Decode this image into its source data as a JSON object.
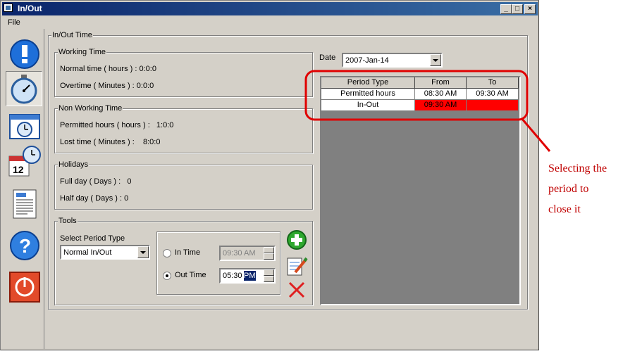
{
  "window": {
    "title": "In/Out"
  },
  "menu": {
    "file": "File"
  },
  "inout_time": {
    "label": "In/Out Time",
    "working_time": {
      "label": "Working Time",
      "normal_time": "Normal time ( hours ) : 0:0:0",
      "overtime": "Overtime ( Minutes ) : 0:0:0"
    },
    "non_working_time": {
      "label": "Non Working Time",
      "permitted_hours": "Permitted hours ( hours ) :   1:0:0",
      "lost_time": "Lost time ( Minutes ) :    8:0:0"
    },
    "holidays": {
      "label": "Holidays",
      "full_day": "Full day ( Days ) :   0",
      "half_day": "Half day ( Days ) : 0"
    },
    "tools": {
      "label": "Tools",
      "select_period_type_label": "Select Period Type",
      "period_type_value": "Normal In/Out",
      "in_time_label": "In Time",
      "in_time_value": "09:30 AM",
      "out_time_label": "Out Time",
      "out_time_value": "05:30",
      "out_time_selected": "PM"
    }
  },
  "date": {
    "label": "Date",
    "value": "2007-Jan-14"
  },
  "period_table": {
    "headers": [
      "Period Type",
      "From",
      "To"
    ],
    "rows": [
      [
        "Permitted hours",
        "08:30 AM",
        "09:30 AM"
      ],
      [
        "In-Out",
        "09:30 AM",
        ""
      ]
    ]
  },
  "annotation": {
    "lines": [
      "Selecting the",
      "period to",
      "close it"
    ]
  },
  "colors": {
    "title_bar": "#0a246a",
    "selected_row": "#ff0000",
    "annotation": "#c00000"
  }
}
